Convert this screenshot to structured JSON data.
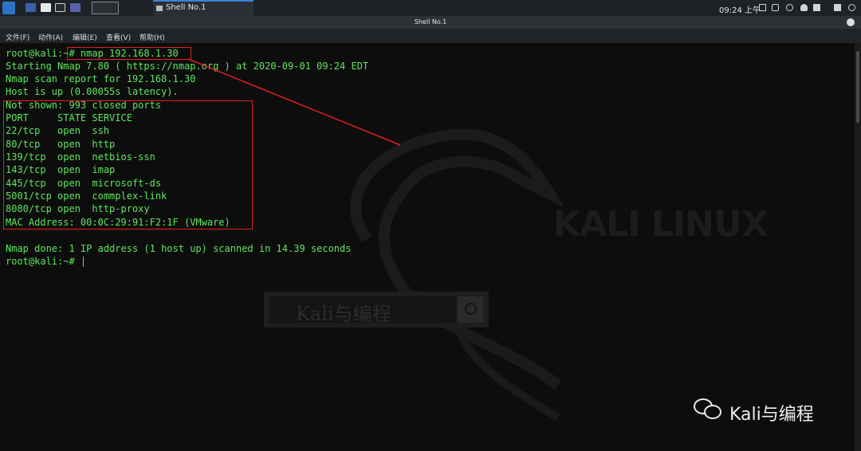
{
  "taskbar": {
    "window_task": "Shell No.1",
    "clock": "09:24 上午"
  },
  "window": {
    "title": "Shell No.1"
  },
  "menu": {
    "items": [
      "文件(F)",
      "动作(A)",
      "编辑(E)",
      "查看(V)",
      "帮助(H)"
    ]
  },
  "terminal": {
    "lines": [
      "root@kali:~# nmap 192.168.1.30",
      "Starting Nmap 7.80 ( https://nmap.org ) at 2020-09-01 09:24 EDT",
      "Nmap scan report for 192.168.1.30",
      "Host is up (0.00055s latency).",
      "Not shown: 993 closed ports",
      "PORT     STATE SERVICE",
      "22/tcp   open  ssh",
      "80/tcp   open  http",
      "139/tcp  open  netbios-ssn",
      "143/tcp  open  imap",
      "445/tcp  open  microsoft-ds",
      "5001/tcp open  commplex-link",
      "8080/tcp open  http-proxy",
      "MAC Address: 00:0C:29:91:F2:1F (VMware)",
      "",
      "Nmap done: 1 IP address (1 host up) scanned in 14.39 seconds",
      "root@kali:~# "
    ]
  },
  "wallpaper": {
    "brand": "KALI LINUX",
    "search_text": "Kali与编程"
  },
  "watermark": {
    "text": "Kali与编程"
  },
  "colors": {
    "terminal_text": "#5ee65e",
    "annotation": "#e02020",
    "accent": "#3d82d4"
  }
}
